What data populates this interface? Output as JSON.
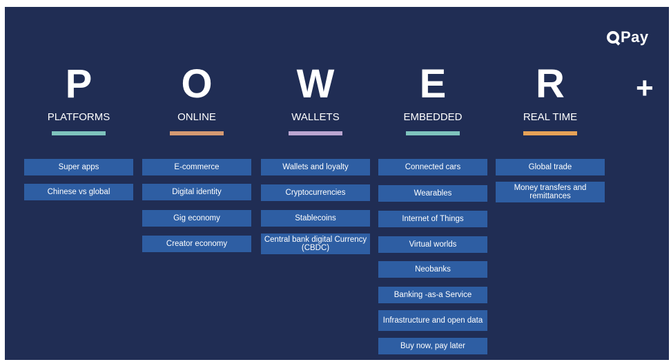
{
  "brand": {
    "name": "Pay"
  },
  "plus": "+",
  "colors": {
    "background": "#202d54",
    "box": "#2e5ea3",
    "platforms": "#7ec3bd",
    "online": "#d59a72",
    "wallets": "#bba6d1",
    "embedded": "#7ec3bd",
    "realtime": "#e7a257"
  },
  "columns": [
    {
      "letter": "P",
      "title": "PLATFORMS",
      "items": [
        "Super apps",
        "Chinese vs global"
      ]
    },
    {
      "letter": "O",
      "title": "ONLINE",
      "items": [
        "E-commerce",
        "Digital identity",
        "Gig economy",
        "Creator economy"
      ]
    },
    {
      "letter": "W",
      "title": "WALLETS",
      "items": [
        "Wallets and loyalty",
        "Cryptocurrencies",
        "Stablecoins",
        "Central bank digital Currency (CBDC)"
      ]
    },
    {
      "letter": "E",
      "title": "EMBEDDED",
      "items": [
        "Connected cars",
        "Wearables",
        "Internet of Things",
        "Virtual worlds",
        "Neobanks",
        "Banking -as-a Service",
        "Infrastructure and open data",
        "Buy now, pay later"
      ]
    },
    {
      "letter": "R",
      "title": "REAL TIME",
      "items": [
        "Global trade",
        "Money transfers and remittances"
      ]
    }
  ]
}
